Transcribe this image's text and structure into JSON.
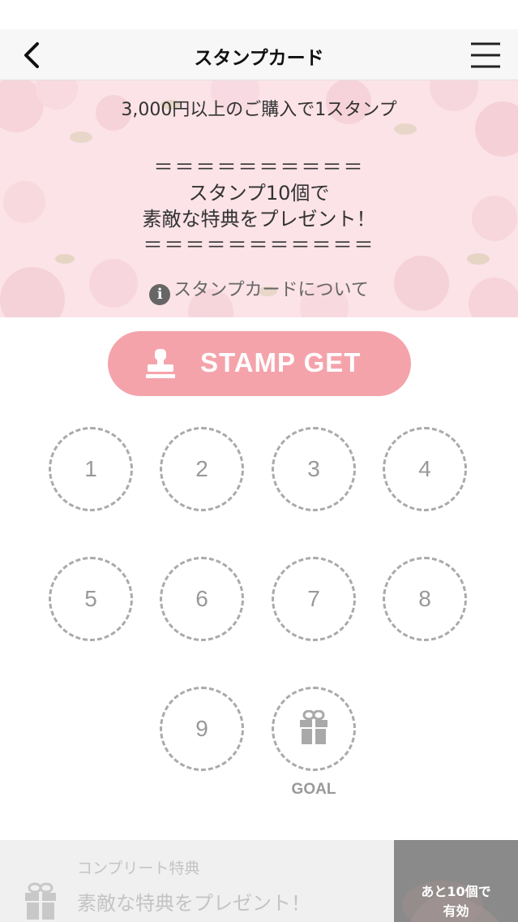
{
  "nav": {
    "title": "スタンプカード",
    "back_icon": "chevron-left-icon",
    "menu_icon": "hamburger-menu-icon"
  },
  "banner": {
    "line1": "3,000円以上のご購入で1スタンプ",
    "divider_top": "＝＝＝＝＝＝＝＝＝＝",
    "line2": "スタンプ10個で",
    "line3": "素敵な特典をプレゼント！",
    "divider_bottom": "＝＝＝＝＝＝＝＝＝＝＝",
    "about_link": "スタンプカードについて"
  },
  "stamp_button": {
    "label": "STAMP GET"
  },
  "stamps": {
    "s1": "1",
    "s2": "2",
    "s3": "3",
    "s4": "4",
    "s5": "5",
    "s6": "6",
    "s7": "7",
    "s8": "8",
    "s9": "9",
    "goal_label": "GOAL"
  },
  "bottom": {
    "complete_label": "コンプリート特典",
    "complete_desc": "素敵な特典をプレゼント！",
    "remaining_line1": "あと10個で",
    "remaining_line2": "有効"
  },
  "colors": {
    "accent": "#f5a3ab",
    "banner_bg": "#fbe3e8",
    "stamp_border": "#aaaaaa"
  }
}
